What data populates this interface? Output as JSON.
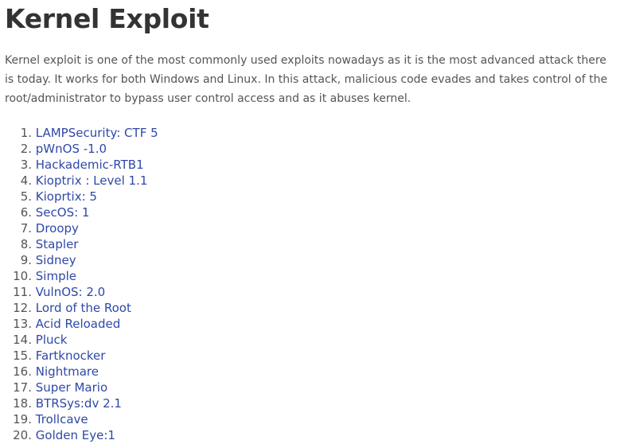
{
  "article": {
    "title": "Kernel Exploit",
    "intro": "Kernel exploit is one of the most commonly used exploits nowadays as it is the most advanced attack there is today. It works for both Windows and Linux. In this attack, malicious code evades and takes control of the root/administrator to bypass user control access and as it abuses kernel.",
    "items": [
      {
        "number": "1.",
        "label": "LAMPSecurity: CTF 5"
      },
      {
        "number": "2.",
        "label": "pWnOS -1.0"
      },
      {
        "number": "3.",
        "label": "Hackademic-RTB1"
      },
      {
        "number": "4.",
        "label": "Kioptrix : Level 1.1"
      },
      {
        "number": "5.",
        "label": "Kioprtix: 5"
      },
      {
        "number": "6.",
        "label": "SecOS: 1"
      },
      {
        "number": "7.",
        "label": "Droopy"
      },
      {
        "number": "8.",
        "label": "Stapler"
      },
      {
        "number": "9.",
        "label": "Sidney"
      },
      {
        "number": "10.",
        "label": "Simple"
      },
      {
        "number": "11.",
        "label": "VulnOS: 2.0"
      },
      {
        "number": "12.",
        "label": "Lord of the Root"
      },
      {
        "number": "13.",
        "label": "Acid Reloaded"
      },
      {
        "number": "14.",
        "label": "Pluck"
      },
      {
        "number": "15.",
        "label": "Fartknocker"
      },
      {
        "number": "16.",
        "label": "Nightmare"
      },
      {
        "number": "17.",
        "label": "Super Mario"
      },
      {
        "number": "18.",
        "label": "BTRSys:dv 2.1"
      },
      {
        "number": "19.",
        "label": "Trollcave"
      },
      {
        "number": "20.",
        "label": "Golden Eye:1"
      }
    ]
  },
  "colors": {
    "heading": "#333333",
    "text": "#555555",
    "link": "#2f48a8",
    "background": "#ffffff"
  }
}
